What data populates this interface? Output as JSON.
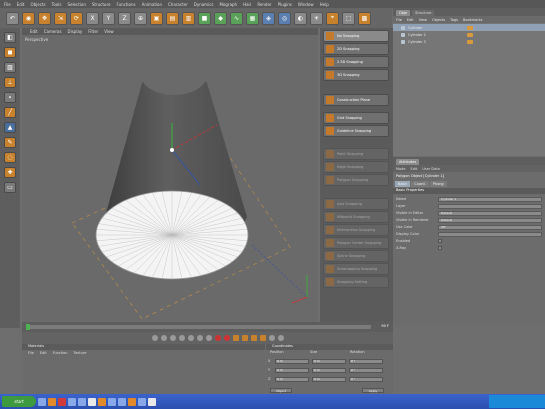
{
  "menubar": [
    "File",
    "Edit",
    "Objects",
    "Tools",
    "Selection",
    "Structure",
    "Functions",
    "Animation",
    "Character",
    "Dynamics",
    "Mograph",
    "Hair",
    "Render",
    "Plugins",
    "Window",
    "Help"
  ],
  "viewport": {
    "menu": [
      "Edit",
      "Cameras",
      "Display",
      "Filter",
      "View"
    ],
    "label": "Perspective"
  },
  "snapping": [
    {
      "label": "No Snapping",
      "state": "active"
    },
    {
      "label": "2D Snapping",
      "state": "normal"
    },
    {
      "label": "2.5D Snapping",
      "state": "normal"
    },
    {
      "label": "3D Snapping",
      "state": "normal"
    },
    {
      "label": "Construction Plane",
      "state": "normal"
    },
    {
      "label": "Grid Snapping",
      "state": "normal"
    },
    {
      "label": "Guideline Snapping",
      "state": "normal"
    },
    {
      "label": "Point Snapping",
      "state": "disabled"
    },
    {
      "label": "Edge Snapping",
      "state": "disabled"
    },
    {
      "label": "Polygon Snapping",
      "state": "disabled"
    },
    {
      "label": "Axis Snapping",
      "state": "disabled"
    },
    {
      "label": "Midpoint Snapping",
      "state": "disabled"
    },
    {
      "label": "Intersection Snapping",
      "state": "disabled"
    },
    {
      "label": "Polygon Center Snapping",
      "state": "disabled"
    },
    {
      "label": "Spline Snapping",
      "state": "disabled"
    },
    {
      "label": "Subsnapping Snapping",
      "state": "disabled"
    },
    {
      "label": "Snapping Setting",
      "state": "disabled"
    }
  ],
  "object_manager": {
    "tabs": [
      "Obje",
      "Structure"
    ],
    "menu": [
      "File",
      "Edit",
      "View",
      "Objects",
      "Tags",
      "Bookmarks"
    ],
    "objects": [
      {
        "name": "Cylinder",
        "selected": true
      },
      {
        "name": "Cylinder 2",
        "selected": false
      },
      {
        "name": "Cylinder 3",
        "selected": false
      }
    ]
  },
  "attributes": {
    "tab": "Attributes",
    "menu": [
      "Mode",
      "Edit",
      "User Data"
    ],
    "title": "Polygon Object [Cylinder 1]",
    "subtabs": [
      {
        "label": "Basic",
        "selected": true
      },
      {
        "label": "Coord.",
        "selected": false
      },
      {
        "label": "Phong",
        "selected": false
      }
    ],
    "section": "Basic Properties",
    "rows": [
      {
        "key": "Name",
        "value": "Cylinder 1"
      },
      {
        "key": "Layer",
        "value": ""
      },
      {
        "key": "Visible in Editor",
        "value": "Default"
      },
      {
        "key": "Visible in Renderer",
        "value": "Default"
      },
      {
        "key": "Use Color",
        "value": "Off"
      },
      {
        "key": "Display Color",
        "value": ""
      },
      {
        "key": "Enabled",
        "value": "check"
      },
      {
        "key": "X-Ray",
        "value": "check"
      }
    ]
  },
  "timeline": {
    "start": "0",
    "end": "90 F"
  },
  "materials": {
    "title": "Materials",
    "menu": [
      "File",
      "Edit",
      "Function",
      "Texture"
    ]
  },
  "coordinates": {
    "title": "Coordinates",
    "headers": [
      "Position",
      "Size",
      "Rotation"
    ],
    "axes": [
      "X",
      "Y",
      "Z"
    ],
    "rows": [
      [
        "0 m",
        "0 m",
        "0 °"
      ],
      [
        "0 m",
        "0 m",
        "0 °"
      ],
      [
        "0 m",
        "0 m",
        "0 °"
      ]
    ],
    "mode": "Object",
    "apply": "Apply"
  },
  "taskbar": {
    "start": "start"
  }
}
